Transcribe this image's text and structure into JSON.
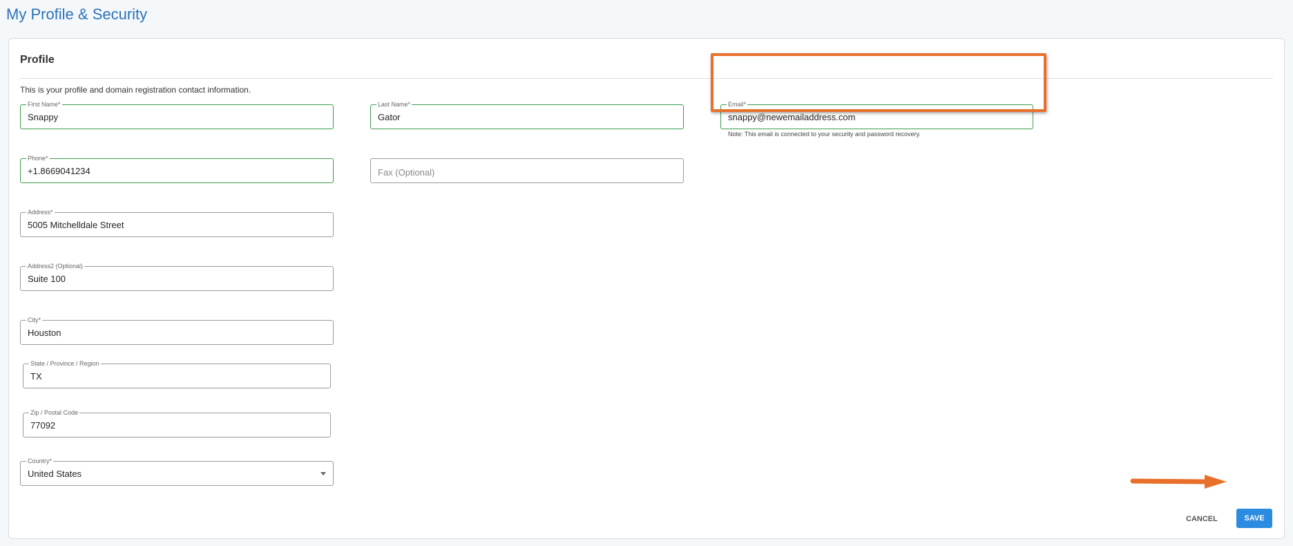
{
  "page": {
    "title": "My Profile & Security"
  },
  "profile": {
    "title": "Profile",
    "intro": "This is your profile and domain registration contact information.",
    "first_name": {
      "label": "First Name*",
      "value": "Snappy"
    },
    "last_name": {
      "label": "Last Name*",
      "value": "Gator"
    },
    "email": {
      "label": "Email*",
      "value": "snappy@newemailaddress.com",
      "note": "Note: This email is connected to your security and password recovery."
    },
    "phone": {
      "label": "Phone*",
      "value": "+1.8669041234"
    },
    "fax": {
      "placeholder": "Fax (Optional)"
    },
    "address": {
      "label": "Address*",
      "value": "5005 Mitchelldale Street"
    },
    "address2": {
      "label": "Address2 (Optional)",
      "value": "Suite 100"
    },
    "city": {
      "label": "City*",
      "value": "Houston"
    },
    "state": {
      "label": "State / Province / Region",
      "value": "TX"
    },
    "zip": {
      "label": "Zip / Postal Code",
      "value": "77092"
    },
    "country": {
      "label": "Country*",
      "value": "United States"
    }
  },
  "actions": {
    "cancel_label": "CANCEL",
    "save_label": "SAVE"
  },
  "colors": {
    "title": "#2b72b8",
    "valid_border": "#3c9a4a",
    "highlight": "#e8702a",
    "save_button": "#2b8be0"
  }
}
